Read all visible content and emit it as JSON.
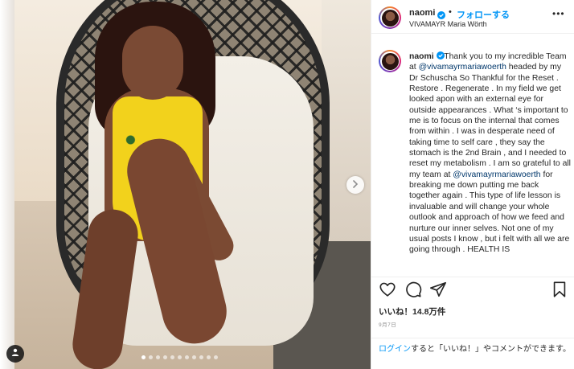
{
  "post": {
    "username": "naomi",
    "follow_label": "フォローする",
    "separator": "•",
    "location": "VIVAMAYR Maria Wörth",
    "more_label": "•••"
  },
  "caption": {
    "username": "naomi",
    "segments": [
      {
        "text": " Thank you to my incredible Team at ",
        "mention": false
      },
      {
        "text": "@vivamayrmariawoerth",
        "mention": true
      },
      {
        "text": " headed by my Dr Schuscha So Thankful for the Reset . Restore . Regenerate . In my field we get looked apon with an external eye for outside appearances . What ‘s important to me is to focus on the internal that comes from within . I was in desperate need of taking time to self care , they say the stomach is the 2nd Brain , and I needed to reset my metabolism . I am so grateful to all my team at ",
        "mention": false
      },
      {
        "text": "@vivamayrmariawoerth",
        "mention": true
      },
      {
        "text": " for breaking me down putting me back together again . This type of life lesson is invaluable and will change your whole outlook and approach of how we feed and nurture our inner selves. Not one of my usual posts I know , but i felt with all we are going through . HEALTH IS",
        "mention": false
      }
    ]
  },
  "likes": "いいね！14.8万件",
  "date": "9月7日",
  "login": {
    "link": "ログイン",
    "rest": "すると「いいね！」やコメントができます。"
  },
  "carousel": {
    "count": 11,
    "active_index": 0
  },
  "icons": [
    "verified-badge-icon",
    "more-options-icon",
    "heart-icon",
    "comment-icon",
    "share-icon",
    "bookmark-icon",
    "chevron-right-icon",
    "user-tag-icon"
  ],
  "colors": {
    "accent_blue": "#0095f6",
    "mention_blue": "#00376b",
    "text": "#262626",
    "muted": "#8e8e8e",
    "swimsuit_yellow": "#f2d21c"
  }
}
